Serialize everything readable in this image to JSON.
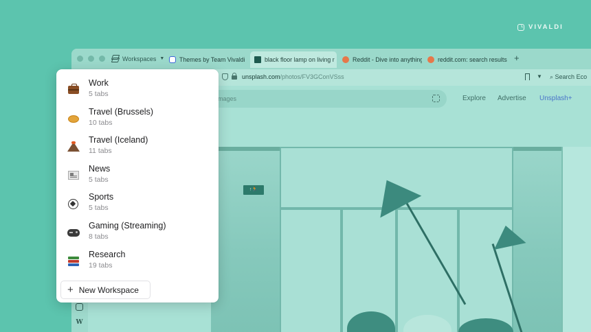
{
  "brand": {
    "name": "VIVALDI",
    "icon": "vivaldi-logo-icon"
  },
  "tabbar": {
    "workspaces_label": "Workspaces",
    "tabs": [
      {
        "label": "Themes by Team Vivaldi",
        "icon": "vivaldi-favicon",
        "active": false
      },
      {
        "label": "black floor lamp on living r",
        "icon": "unsplash-favicon",
        "active": true
      },
      {
        "label": "Reddit - Dive into anything",
        "icon": "reddit-favicon",
        "active": false
      },
      {
        "label": "reddit.com: search results",
        "icon": "reddit-favicon",
        "active": false
      }
    ],
    "new_tab_label": "+"
  },
  "addressbar": {
    "url_host": "unsplash.com",
    "url_path": "/photos/FV3GConVSss",
    "search_placeholder": "Search Eco"
  },
  "page": {
    "search_placeholder": "mages",
    "nav": [
      "Explore",
      "Advertise",
      "Unsplash+"
    ],
    "exit_sign": "↑🏃"
  },
  "popup": {
    "workspaces": [
      {
        "name": "Work",
        "count": "5 tabs",
        "icon": "briefcase-icon"
      },
      {
        "name": "Travel (Brussels)",
        "count": "10 tabs",
        "icon": "waffle-icon"
      },
      {
        "name": "Travel (Iceland)",
        "count": "11 tabs",
        "icon": "volcano-icon"
      },
      {
        "name": "News",
        "count": "5 tabs",
        "icon": "newspaper-icon"
      },
      {
        "name": "Sports",
        "count": "5 tabs",
        "icon": "soccer-ball-icon"
      },
      {
        "name": "Gaming (Streaming)",
        "count": "8 tabs",
        "icon": "gamepad-icon"
      },
      {
        "name": "Research",
        "count": "19 tabs",
        "icon": "books-icon"
      }
    ],
    "new_workspace_label": "New Workspace"
  },
  "colors": {
    "background": "#5cc4ae",
    "accent_link": "#4a74c9"
  }
}
